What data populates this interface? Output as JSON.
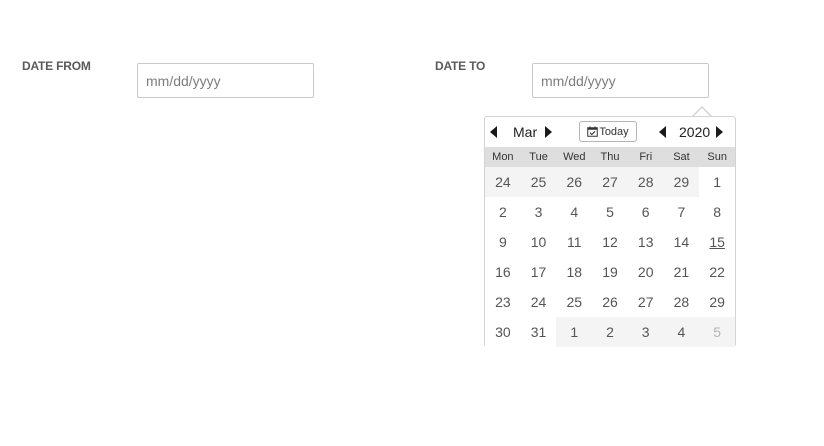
{
  "form": {
    "date_from": {
      "label": "DATE FROM",
      "placeholder": "mm/dd/yyyy",
      "value": ""
    },
    "date_to": {
      "label": "DATE TO",
      "placeholder": "mm/dd/yyyy",
      "value": ""
    }
  },
  "datepicker": {
    "month": "Mar",
    "year": "2020",
    "today_label": "Today",
    "weekdays": [
      "Mon",
      "Tue",
      "Wed",
      "Thu",
      "Fri",
      "Sat",
      "Sun"
    ],
    "days": [
      {
        "d": "24",
        "cur": false
      },
      {
        "d": "25",
        "cur": false
      },
      {
        "d": "26",
        "cur": false
      },
      {
        "d": "27",
        "cur": false
      },
      {
        "d": "28",
        "cur": false
      },
      {
        "d": "29",
        "cur": false
      },
      {
        "d": "1",
        "cur": true
      },
      {
        "d": "2",
        "cur": true
      },
      {
        "d": "3",
        "cur": true
      },
      {
        "d": "4",
        "cur": true
      },
      {
        "d": "5",
        "cur": true
      },
      {
        "d": "6",
        "cur": true
      },
      {
        "d": "7",
        "cur": true
      },
      {
        "d": "8",
        "cur": true
      },
      {
        "d": "9",
        "cur": true
      },
      {
        "d": "10",
        "cur": true
      },
      {
        "d": "11",
        "cur": true
      },
      {
        "d": "12",
        "cur": true
      },
      {
        "d": "13",
        "cur": true
      },
      {
        "d": "14",
        "cur": true
      },
      {
        "d": "15",
        "cur": true,
        "today": true
      },
      {
        "d": "16",
        "cur": true
      },
      {
        "d": "17",
        "cur": true
      },
      {
        "d": "18",
        "cur": true
      },
      {
        "d": "19",
        "cur": true
      },
      {
        "d": "20",
        "cur": true
      },
      {
        "d": "21",
        "cur": true
      },
      {
        "d": "22",
        "cur": true
      },
      {
        "d": "23",
        "cur": true
      },
      {
        "d": "24",
        "cur": true
      },
      {
        "d": "25",
        "cur": true
      },
      {
        "d": "26",
        "cur": true
      },
      {
        "d": "27",
        "cur": true
      },
      {
        "d": "28",
        "cur": true
      },
      {
        "d": "29",
        "cur": true
      },
      {
        "d": "30",
        "cur": true
      },
      {
        "d": "31",
        "cur": true
      },
      {
        "d": "1",
        "cur": false
      },
      {
        "d": "2",
        "cur": false
      },
      {
        "d": "3",
        "cur": false
      },
      {
        "d": "4",
        "cur": false
      },
      {
        "d": "5",
        "cur": false,
        "dim": true
      }
    ]
  },
  "icons": {
    "month_prev": "caret-left-icon",
    "month_next": "caret-right-icon",
    "year_prev": "caret-left-icon",
    "year_next": "caret-right-icon",
    "today": "calendar-check-icon"
  },
  "colors": {
    "weekday_header_bg": "#dedede",
    "other_month_bg": "#f4f4f4",
    "current_month_bg": "#ffffff",
    "text": "#555555"
  }
}
